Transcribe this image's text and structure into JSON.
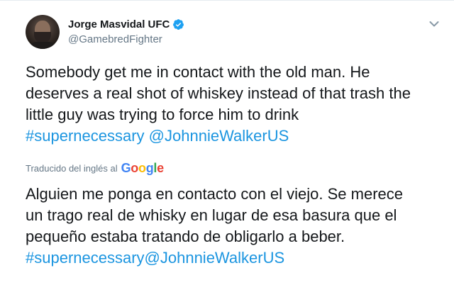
{
  "author": {
    "display_name": "Jorge Masvidal UFC",
    "handle": "@GamebredFighter",
    "avatar_icon": "profile-photo",
    "verified_icon": "verified-badge-icon"
  },
  "tweet": {
    "lines": [
      "Somebody get me in contact with the old man. He",
      "deserves a real shot of whiskey instead of that trash the",
      "little guy was trying to force him to drink"
    ],
    "hashtag": "#supernecessary",
    "mention": "@JohnnieWalkerUS"
  },
  "translation": {
    "label": "Traducido del inglés al",
    "provider": "Google",
    "lines": [
      "Alguien me ponga en contacto con el viejo. Se merece",
      "un trago real de whisky en lugar de esa basura que el",
      "pequeño estaba tratando de obligarlo a beber."
    ],
    "hashtag_mention": "#supernecessary@JohnnieWalkerUS"
  },
  "colors": {
    "link": "#1b95e0",
    "verified": "#1da1f2",
    "text": "#14171a",
    "secondary": "#657786"
  }
}
